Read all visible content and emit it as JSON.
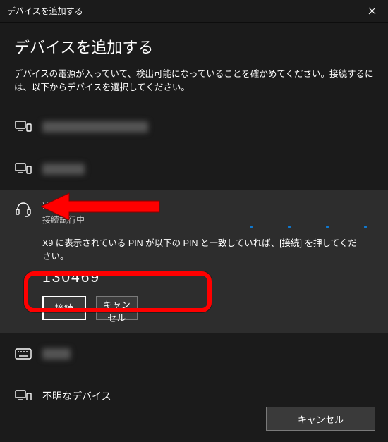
{
  "titlebar": {
    "title": "デバイスを追加する"
  },
  "header": {
    "title": "デバイスを追加する",
    "instruction": "デバイスの電源が入っていて、検出可能になっていることを確かめてください。接続するには、以下からデバイスを選択してください。"
  },
  "devices": {
    "redacted1": {
      "label": ""
    },
    "redacted2": {
      "label": ""
    },
    "x9": {
      "name": "X9",
      "status": "接続試行中",
      "pin_message": "X9 に表示されている PIN が以下の PIN と一致していれば、[接続] を押してください。",
      "pin_code": "130469",
      "connect": "接続",
      "cancel": "キャンセル"
    },
    "redacted3": {
      "label": ""
    },
    "unknown": {
      "label": "不明なデバイス"
    }
  },
  "footer": {
    "cancel": "キャンセル"
  }
}
